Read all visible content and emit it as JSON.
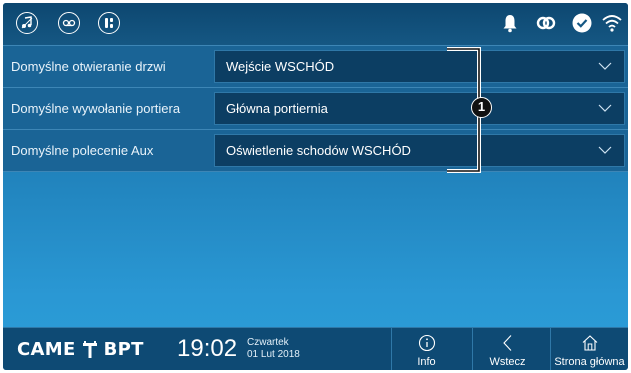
{
  "status_bar": {
    "left_icons": [
      "music-note-icon",
      "voicemail-icon",
      "keypad-icon"
    ],
    "right_icons": [
      "bell-icon",
      "link-icon",
      "check-circle-icon",
      "wifi-icon"
    ]
  },
  "settings": {
    "rows": [
      {
        "label": "Domyślne otwieranie drzwi",
        "value": "Wejście WSCHÓD"
      },
      {
        "label": "Domyślne wywołanie portiera",
        "value": "Główna portiernia"
      },
      {
        "label": "Domyślne polecenie Aux",
        "value": "Oświetlenie schodów WSCHÓD"
      }
    ]
  },
  "callout": {
    "number": "1"
  },
  "footer": {
    "logo_left": "CAME",
    "logo_right": "BPT",
    "time": "19:02",
    "day": "Czwartek",
    "date": "01 Lut 2018",
    "nav": [
      {
        "label": "Info",
        "icon": "info-icon"
      },
      {
        "label": "Wstecz",
        "icon": "back-chevron-icon"
      },
      {
        "label": "Strona główna",
        "icon": "home-icon"
      }
    ]
  },
  "colors": {
    "status_bar": "#0d4770",
    "row_background": "#1a6496",
    "select_background": "#0c3e63",
    "screen_gradient_bottom": "#2c9ed8"
  }
}
